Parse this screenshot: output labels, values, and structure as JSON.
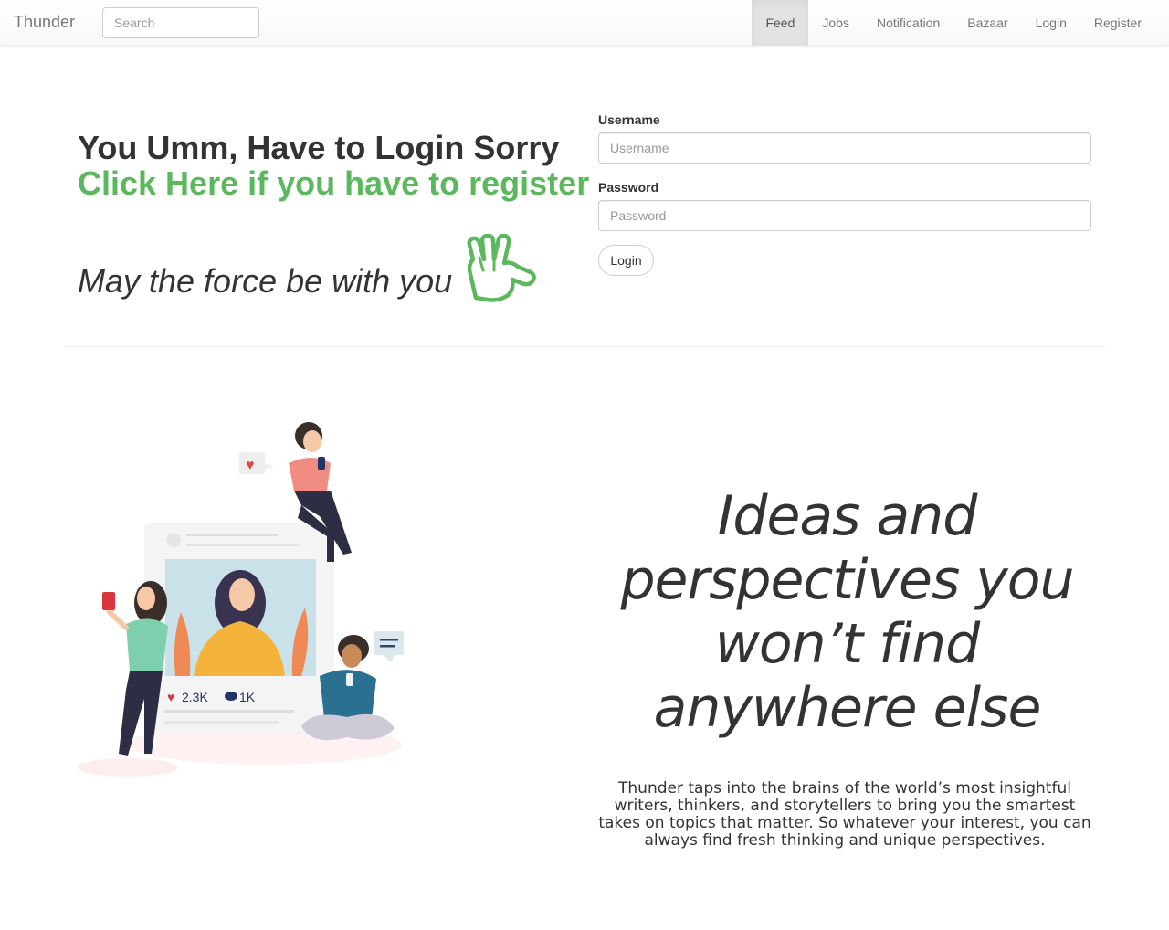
{
  "navbar": {
    "brand": "Thunder",
    "search_placeholder": "Search",
    "items": [
      {
        "label": "Feed",
        "active": true
      },
      {
        "label": "Jobs",
        "active": false
      },
      {
        "label": "Notification",
        "active": false
      },
      {
        "label": "Bazaar",
        "active": false
      },
      {
        "label": "Login",
        "active": false
      },
      {
        "label": "Register",
        "active": false
      }
    ]
  },
  "hero": {
    "login_prompt": "You Umm, Have to Login Sorry",
    "register_link": "Click Here if you have to register",
    "farewell": "May the force be with you",
    "hand_icon": "vulcan-salute-icon"
  },
  "form": {
    "username_label": "Username",
    "username_placeholder": "Username",
    "password_label": "Password",
    "password_placeholder": "Password",
    "login_button": "Login"
  },
  "illustration": {
    "likes": "2.3K",
    "comments": "1K"
  },
  "promo": {
    "tagline": "Ideas and perspectives you won’t find anywhere else",
    "description": "Thunder taps into the brains of the world’s most insightful writers, thinkers, and storytellers to bring you the smartest takes on topics that matter. So whatever your interest, you can always find fresh thinking and unique perspectives."
  },
  "colors": {
    "accent_green": "#5cb85c",
    "text": "#333333",
    "nav_text": "#777777",
    "nav_active_bg": "#e3e3e3"
  }
}
